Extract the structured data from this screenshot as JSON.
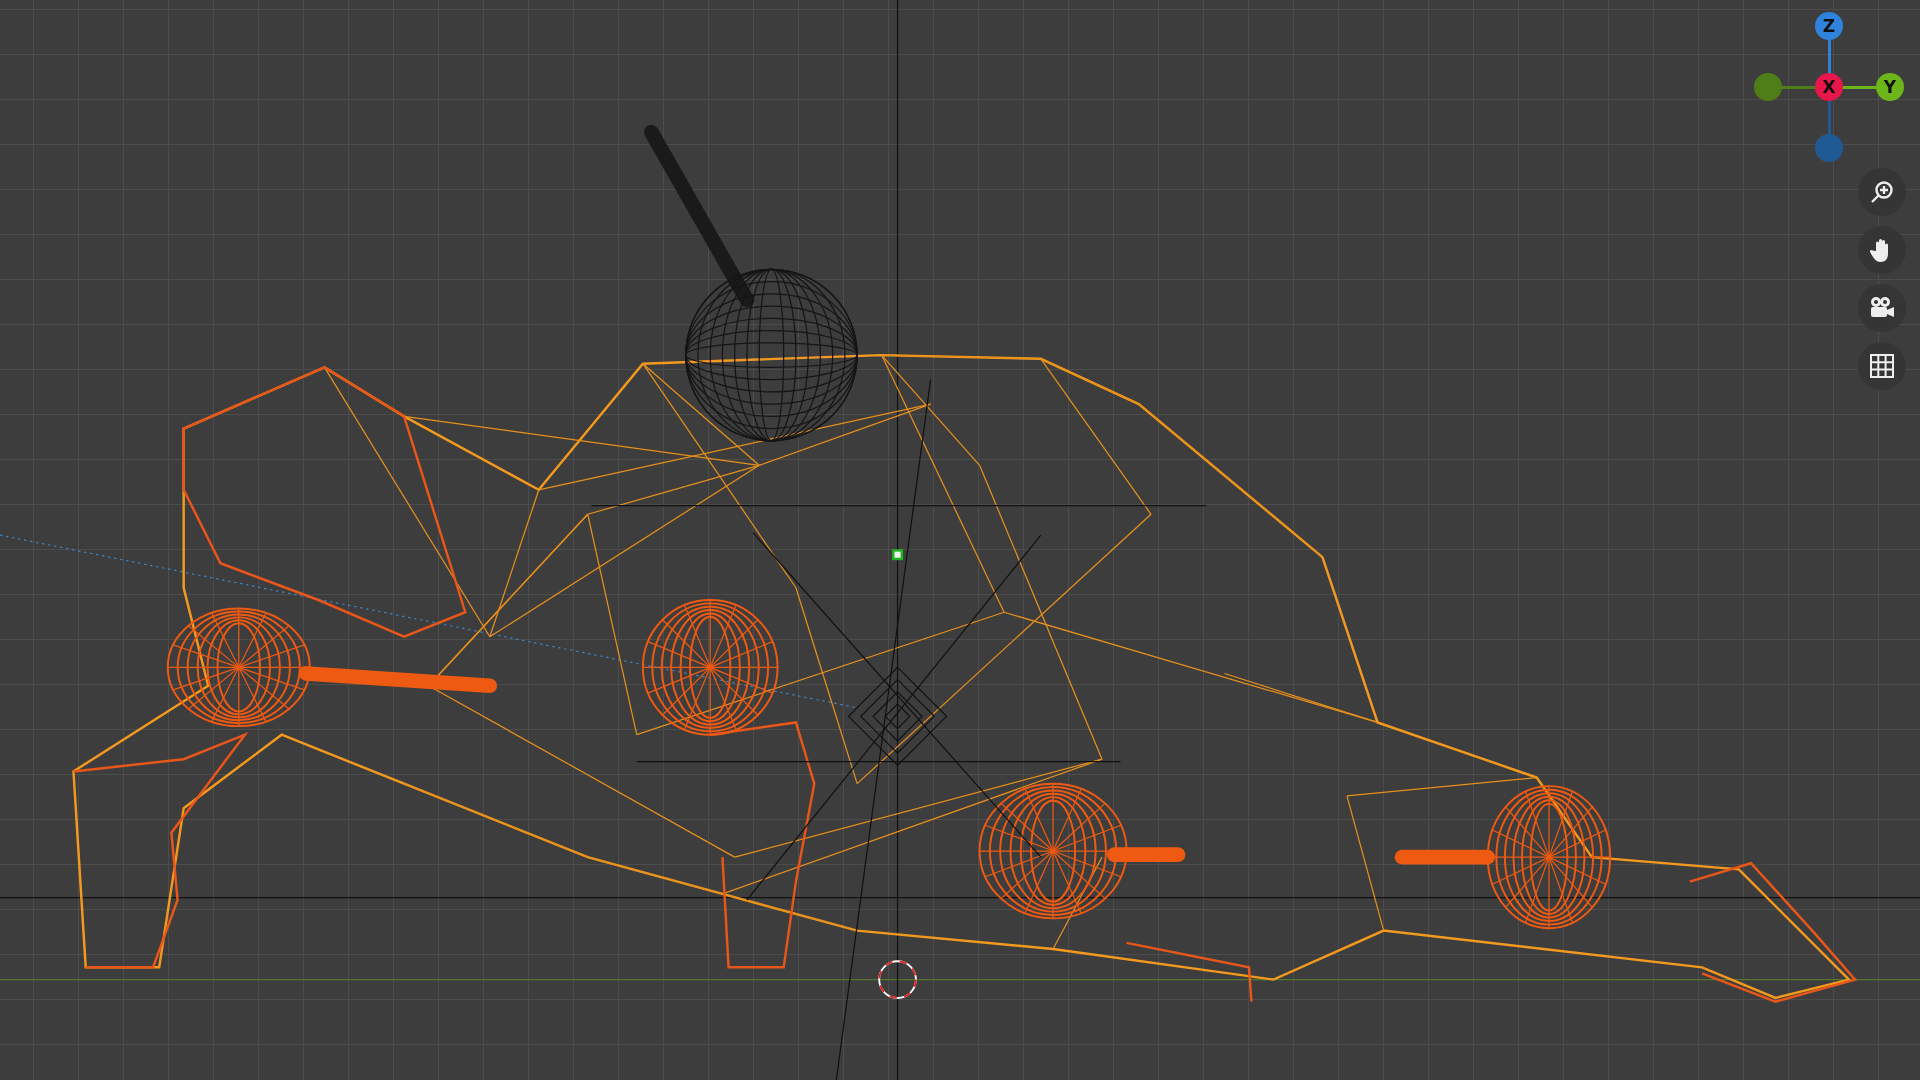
{
  "gizmo": {
    "axes": [
      {
        "label": "Z",
        "color": "#2f83dc",
        "kind": "positive"
      },
      {
        "label": "X",
        "color": "#e8174b",
        "kind": "positive"
      },
      {
        "label": "Y",
        "color": "#6cb61c",
        "kind": "positive"
      },
      {
        "color": "#4f7d17",
        "kind": "negative"
      },
      {
        "color": "#1f5a94",
        "kind": "negative"
      }
    ]
  },
  "navigation": [
    {
      "kind": "zoom"
    },
    {
      "kind": "pan"
    },
    {
      "kind": "camera"
    },
    {
      "kind": "grid"
    }
  ]
}
